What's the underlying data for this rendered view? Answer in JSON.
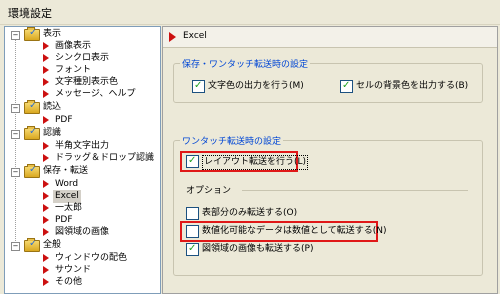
{
  "window": {
    "title": "環境設定"
  },
  "tree": {
    "groups": [
      {
        "label": "表示",
        "expander": "−",
        "children": [
          "画像表示",
          "シンクロ表示",
          "フォント",
          "文字種別表示色",
          "メッセージ、ヘルプ"
        ]
      },
      {
        "label": "読込",
        "expander": "−",
        "children": [
          "PDF"
        ]
      },
      {
        "label": "認識",
        "expander": "−",
        "children": [
          "半角文字出力",
          "ドラッグ＆ドロップ認識"
        ]
      },
      {
        "label": "保存・転送",
        "expander": "−",
        "children": [
          "Word",
          "Excel",
          "一太郎",
          "PDF",
          "図領域の画像"
        ]
      },
      {
        "label": "全般",
        "expander": "−",
        "children": [
          "ウィンドウの配色",
          "サウンド",
          "その他"
        ]
      }
    ],
    "selected": "Excel"
  },
  "panel": {
    "header": "Excel",
    "group_save": {
      "title": "保存・ワンタッチ転送時の設定",
      "checkboxes": [
        {
          "label": "文字色の出力を行う(M)",
          "checked": true
        },
        {
          "label": "セルの背景色を出力する(B)",
          "checked": true
        }
      ]
    },
    "group_onetouch": {
      "title": "ワンタッチ転送時の設定",
      "layout_checkbox": {
        "label": "レイアウト転送を行う(L)",
        "checked": true
      },
      "options_label": "オプション",
      "options": [
        {
          "label": "表部分のみ転送する(O)",
          "checked": false
        },
        {
          "label": "数値化可能なデータは数値として転送する(N)",
          "checked": false
        },
        {
          "label": "図領域の画像も転送する(P)",
          "checked": true
        }
      ]
    }
  },
  "colors": {
    "highlight_box": "#e01818",
    "group_title": "#0046d5",
    "leaf_arrow": "#cc1010"
  }
}
